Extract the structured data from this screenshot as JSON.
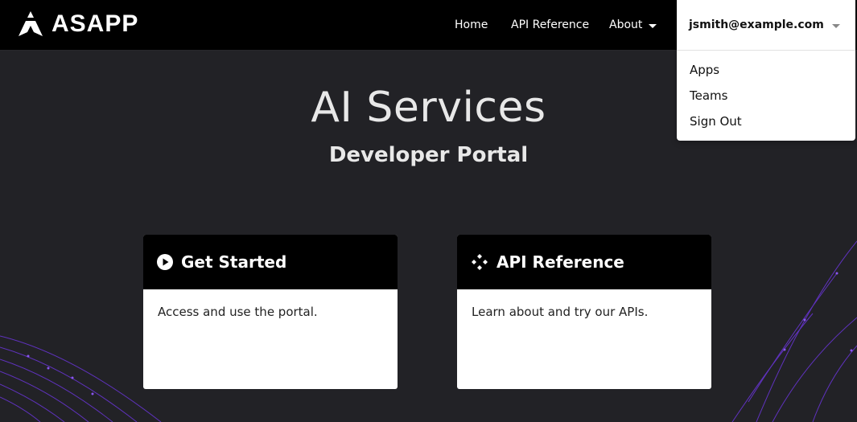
{
  "brand": {
    "name": "ASAPP"
  },
  "nav": {
    "home": "Home",
    "api_reference": "API Reference",
    "about": "About"
  },
  "user_menu": {
    "email": "jsmith@example.com",
    "items": [
      "Apps",
      "Teams",
      "Sign Out"
    ]
  },
  "hero": {
    "title": "AI Services",
    "subtitle": "Developer Portal"
  },
  "cards": [
    {
      "title": "Get Started",
      "icon": "play-circle-icon",
      "description": "Access and use the portal."
    },
    {
      "title": "API Reference",
      "icon": "api-diamond-icon",
      "description": "Learn about and try our APIs."
    }
  ],
  "colors": {
    "background": "#222226",
    "header": "#000000",
    "accent_lines": "#7b3fe4"
  }
}
